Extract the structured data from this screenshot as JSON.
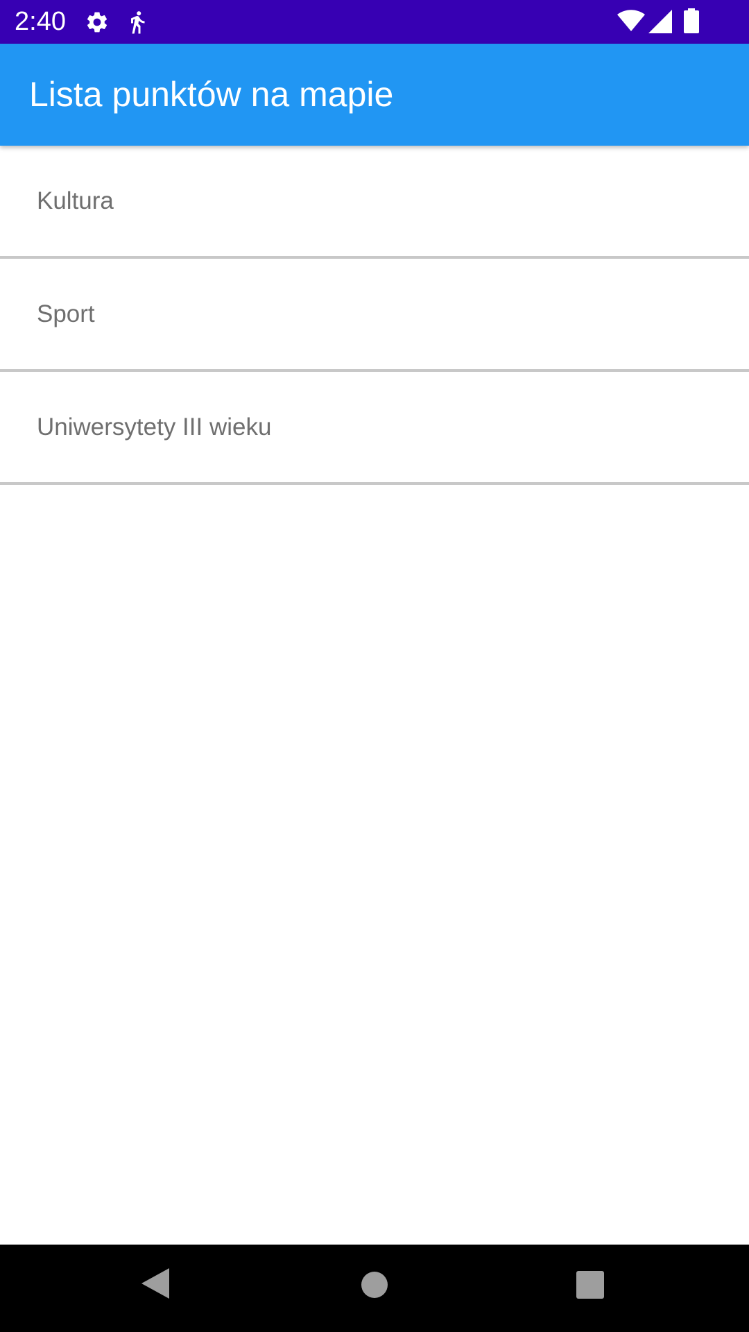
{
  "status_bar": {
    "time": "2:40",
    "background": "#3700B3",
    "icons": [
      "settings-icon",
      "walking-icon",
      "wifi-icon",
      "signal-icon",
      "battery-icon"
    ]
  },
  "app_bar": {
    "title": "Lista punktów na mapie",
    "background": "#2196F3"
  },
  "list": {
    "items": [
      {
        "label": "Kultura"
      },
      {
        "label": "Sport"
      },
      {
        "label": "Uniwersytety III wieku"
      }
    ],
    "divider_color": "#C8C8C8",
    "text_color": "#6F6F6F"
  },
  "nav_bar": {
    "buttons": [
      "back-icon",
      "home-icon",
      "recents-icon"
    ]
  }
}
